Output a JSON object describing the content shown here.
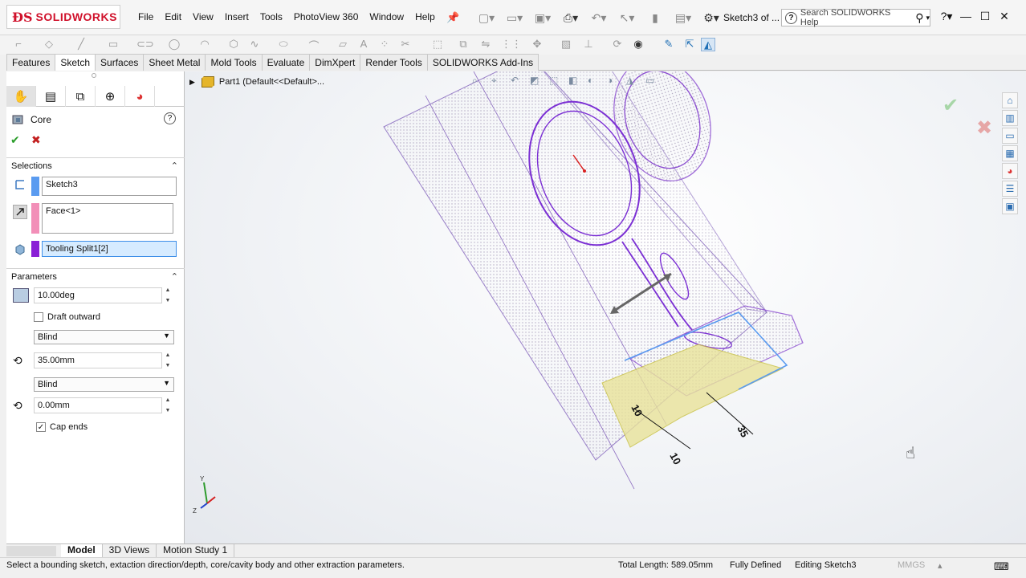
{
  "app": {
    "brand": "SOLIDWORKS",
    "document_title": "Sketch3 of ...",
    "help_search_placeholder": "Search SOLIDWORKS Help",
    "menus": [
      "File",
      "Edit",
      "View",
      "Insert",
      "Tools",
      "PhotoView 360",
      "Window",
      "Help"
    ]
  },
  "command_tabs": [
    "Features",
    "Sketch",
    "Surfaces",
    "Sheet Metal",
    "Mold Tools",
    "Evaluate",
    "DimXpert",
    "Render Tools",
    "SOLIDWORKS Add-Ins"
  ],
  "active_command_tab": "Sketch",
  "property_manager": {
    "title": "Core",
    "selections": {
      "header": "Selections",
      "sketch": "Sketch3",
      "face": "Face<1>",
      "body": "Tooling Split1[2]"
    },
    "parameters": {
      "header": "Parameters",
      "draft_angle": "10.00deg",
      "draft_outward_label": "Draft outward",
      "end_condition_1": "Blind",
      "depth_1": "35.00mm",
      "end_condition_2": "Blind",
      "depth_2": "0.00mm",
      "cap_ends_label": "Cap ends"
    }
  },
  "feature_tree": {
    "root": "Part1  (Default<<Default>..."
  },
  "bottom_tabs": [
    "Model",
    "3D Views",
    "Motion Study 1"
  ],
  "active_bottom_tab": "Model",
  "status": {
    "message": "Select a bounding sketch, extaction direction/depth, core/cavity body and other extraction parameters.",
    "total_length": "Total Length: 589.05mm",
    "state": "Fully Defined",
    "editing": "Editing Sketch3",
    "units": "MMGS"
  },
  "colors": {
    "brand_red": "#d0112b",
    "sketch_blue": "#5a9bf0",
    "face_pink": "#f28fb8",
    "body_purple": "#8a1fd6"
  }
}
